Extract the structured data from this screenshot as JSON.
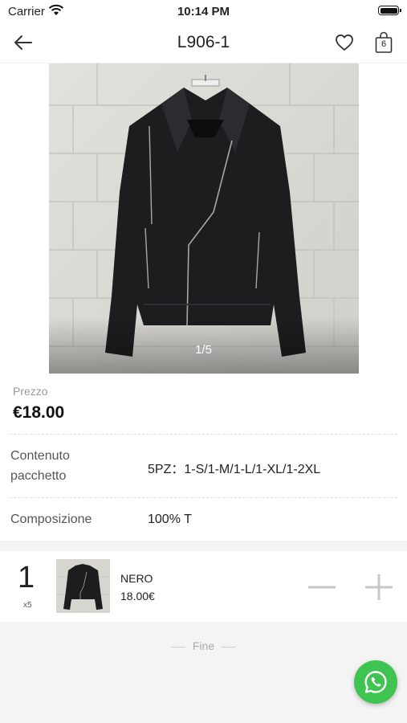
{
  "status_bar": {
    "carrier": "Carrier",
    "time": "10:14 PM"
  },
  "nav": {
    "title": "L906-1",
    "cart_count": "6"
  },
  "gallery": {
    "pager": "1/5"
  },
  "price": {
    "label": "Prezzo",
    "value": "€18.00"
  },
  "details": [
    {
      "label_line1": "Contenuto",
      "label_line2": "pacchetto",
      "value": "5PZ：1-S/1-M/1-L/1-XL/1-2XL"
    },
    {
      "label": "Composizione",
      "value": "100% T"
    }
  ],
  "selection": {
    "quantity": "1",
    "multiplier": "x5",
    "color": "NERO",
    "price": "18.00€"
  },
  "footer": {
    "end_label": "Fine"
  },
  "colors": {
    "whatsapp": "#3fc351",
    "divider": "#e3e3e3"
  },
  "icons": [
    "wifi-icon",
    "battery-icon",
    "back-arrow-icon",
    "heart-icon",
    "shopping-bag-icon",
    "minus-icon",
    "plus-icon",
    "whatsapp-icon"
  ]
}
